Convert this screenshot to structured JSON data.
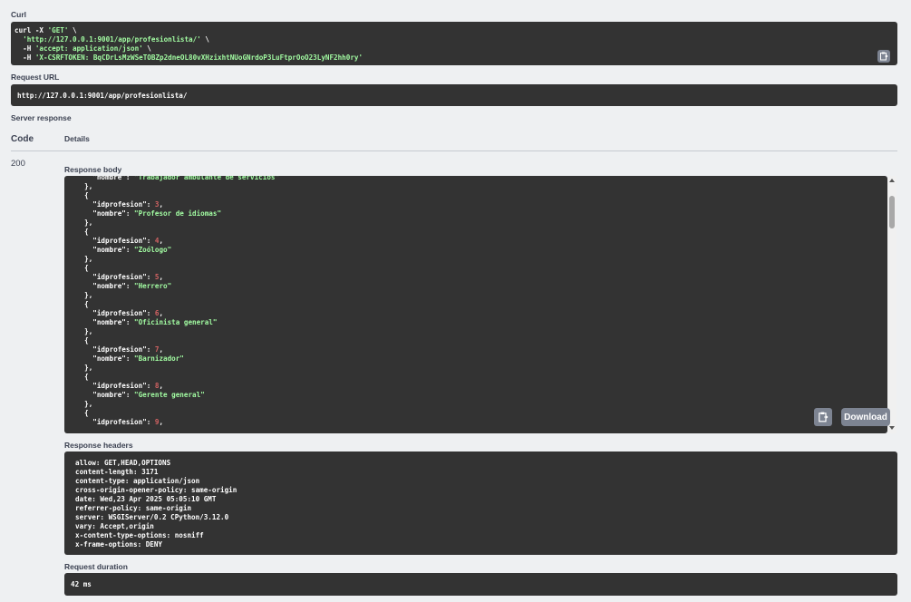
{
  "curl": {
    "label": "Curl",
    "lines": [
      {
        "pre": "curl -X ",
        "s": "'GET'",
        "post": " \\"
      },
      {
        "pre": "  ",
        "s": "'http://127.0.0.1:9001/app/profesionlista/'",
        "post": " \\"
      },
      {
        "pre": "  -H ",
        "s": "'accept: application/json'",
        "post": " \\"
      },
      {
        "pre": "  -H ",
        "s": "'X-CSRFTOKEN: BqCDrLsMzWSeTOBZp2dneOL80vXHzixhtNUoGNrdoP3LuFtprOoO23LyNF2hh0ry'",
        "post": ""
      }
    ]
  },
  "request_url": {
    "label": "Request URL",
    "value": "http://127.0.0.1:9001/app/profesionlista/"
  },
  "server_response": {
    "label": "Server response",
    "col_code": "Code",
    "col_details": "Details",
    "code": "200"
  },
  "response_body": {
    "label": "Response body",
    "entries_before": "\"nombre\": ",
    "first_nombre": "\"Trabajador ambulante de servicios\"",
    "items": [
      {
        "id": "3",
        "nombre": "\"Profesor de idiomas\""
      },
      {
        "id": "4",
        "nombre": "\"Zoólogo\""
      },
      {
        "id": "5",
        "nombre": "\"Herrero\""
      },
      {
        "id": "6",
        "nombre": "\"Oficinista general\""
      },
      {
        "id": "7",
        "nombre": "\"Barnizador\""
      },
      {
        "id": "8",
        "nombre": "\"Gerente general\""
      }
    ],
    "last_id": "9",
    "key_id": "\"idprofesion\": ",
    "key_nombre": "\"nombre\": ",
    "download_label": "Download"
  },
  "response_headers": {
    "label": "Response headers",
    "lines": [
      "allow: GET,HEAD,OPTIONS",
      "content-length: 3171",
      "content-type: application/json",
      "cross-origin-opener-policy: same-origin",
      "date: Wed,23 Apr 2025 05:05:10 GMT",
      "referrer-policy: same-origin",
      "server: WSGIServer/0.2 CPython/3.12.0",
      "vary: Accept,origin",
      "x-content-type-options: nosniff",
      "x-frame-options: DENY"
    ]
  },
  "request_duration": {
    "label": "Request duration",
    "value": "42 ms"
  },
  "icons": {
    "copy": "copy-to-clipboard-icon"
  },
  "colors": {
    "code_bg": "#333333",
    "string": "#a2fca2",
    "number": "#d36363",
    "button": "#7d8492"
  }
}
